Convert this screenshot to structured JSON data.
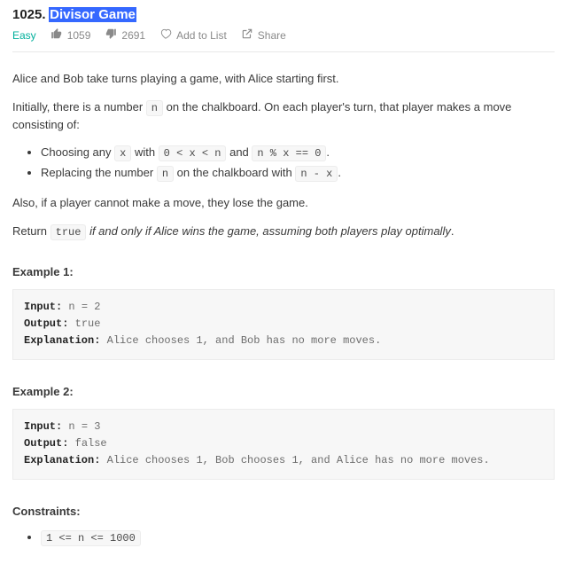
{
  "header": {
    "number": "1025.",
    "title": "Divisor Game",
    "difficulty": "Easy",
    "likes": "1059",
    "dislikes": "2691",
    "add_label": "Add to List",
    "share_label": "Share"
  },
  "description": {
    "intro": "Alice and Bob take turns playing a game, with Alice starting first.",
    "initial_prefix": "Initially, there is a number ",
    "initial_code_n": "n",
    "initial_suffix": " on the chalkboard. On each player's turn, that player makes a move consisting of:",
    "bullet1_a": "Choosing any ",
    "bullet1_code_x": "x",
    "bullet1_b": " with ",
    "bullet1_code_range": "0 < x < n",
    "bullet1_c": " and ",
    "bullet1_code_mod": "n % x == 0",
    "bullet1_d": ".",
    "bullet2_a": "Replacing the number ",
    "bullet2_code_n": "n",
    "bullet2_b": " on the chalkboard with ",
    "bullet2_code_sub": "n - x",
    "bullet2_c": ".",
    "lose_line": "Also, if a player cannot make a move, they lose the game.",
    "return_a": "Return ",
    "return_code": "true",
    "return_b_italic": " if and only if Alice wins the game, assuming both players play optimally",
    "return_c": "."
  },
  "examples": [
    {
      "heading": "Example 1:",
      "input_label": "Input:",
      "input_value": " n = 2",
      "output_label": "Output:",
      "output_value": " true",
      "explanation_label": "Explanation:",
      "explanation_value": " Alice chooses 1, and Bob has no more moves."
    },
    {
      "heading": "Example 2:",
      "input_label": "Input:",
      "input_value": " n = 3",
      "output_label": "Output:",
      "output_value": " false",
      "explanation_label": "Explanation:",
      "explanation_value": " Alice chooses 1, Bob chooses 1, and Alice has no more moves."
    }
  ],
  "constraints": {
    "heading": "Constraints:",
    "items": [
      "1 <= n <= 1000"
    ]
  }
}
